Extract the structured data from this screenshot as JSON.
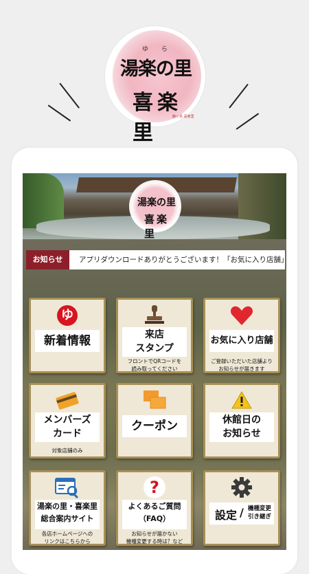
{
  "logo": {
    "ruby": "ゆ ら",
    "line1": "湯楽の里",
    "line2": "喜楽里",
    "small": "鶴ヶ島 喜楽里"
  },
  "app": {
    "news_label": "お知らせ",
    "news_text": "アプリダウンロードありがとうございます！「お気に入り店舗」"
  },
  "tiles": [
    {
      "title": "新着情報",
      "icon": "yu-logo-icon",
      "sub": ""
    },
    {
      "title1": "来店",
      "title2": "スタンプ",
      "icon": "stamp-icon",
      "sub1": "フロントでQRコードを",
      "sub2": "読み取ってください"
    },
    {
      "title": "お気に入り店舗",
      "icon": "heart-icon",
      "sub1": "ご登録いただいた店舗より",
      "sub2": "お知らせが届きます"
    },
    {
      "title1": "メンバーズ",
      "title2": "カード",
      "icon": "member-card-icon",
      "sub1": "対象店舗のみ"
    },
    {
      "title": "クーポン",
      "icon": "coupon-icon",
      "sub": ""
    },
    {
      "title1": "休館日の",
      "title2": "お知らせ",
      "icon": "warning-icon",
      "sub": ""
    },
    {
      "title1": "湯楽の里・喜楽里",
      "title2": "総合案内サイト",
      "icon": "website-icon",
      "sub1": "各店ホームページへの",
      "sub2": "リンクはこちらから"
    },
    {
      "title1": "よくあるご質問",
      "title2": "（FAQ）",
      "icon": "question-icon",
      "sub1": "お知らせが届かない",
      "sub2": "機種変更する時は？など"
    },
    {
      "title_main": "設定",
      "title_sep": "/",
      "title_small1": "機種変更",
      "title_small2": "引き継ぎ",
      "icon": "gear-icon"
    }
  ],
  "colors": {
    "accent": "#8c1f2a",
    "tile_border": "#a88f55",
    "heart": "#e0272f"
  }
}
